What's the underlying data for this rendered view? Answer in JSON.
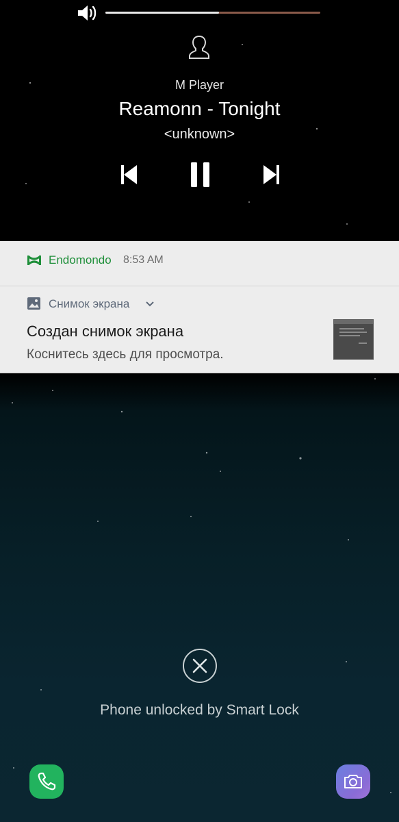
{
  "media": {
    "app_name": "M Player",
    "track_title": "Reamonn - Tonight",
    "artist": "<unknown>",
    "volume_level": 0.53,
    "controls": [
      "previous-icon",
      "pause-icon",
      "next-icon"
    ]
  },
  "notifications": {
    "endomondo": {
      "app_name": "Endomondo",
      "time": "8:53 AM",
      "icon": "endomondo-logo-icon",
      "color": "#1f8f3a"
    },
    "screenshot": {
      "app_name": "Снимок экрана",
      "title": "Создан снимок экрана",
      "text": "Коснитесь здесь для просмотра.",
      "icon": "image-icon"
    }
  },
  "lockscreen": {
    "status_text": "Phone unlocked by Smart Lock",
    "status_icon": "close-circle-icon",
    "shortcuts": [
      "phone-icon",
      "camera-icon"
    ]
  }
}
